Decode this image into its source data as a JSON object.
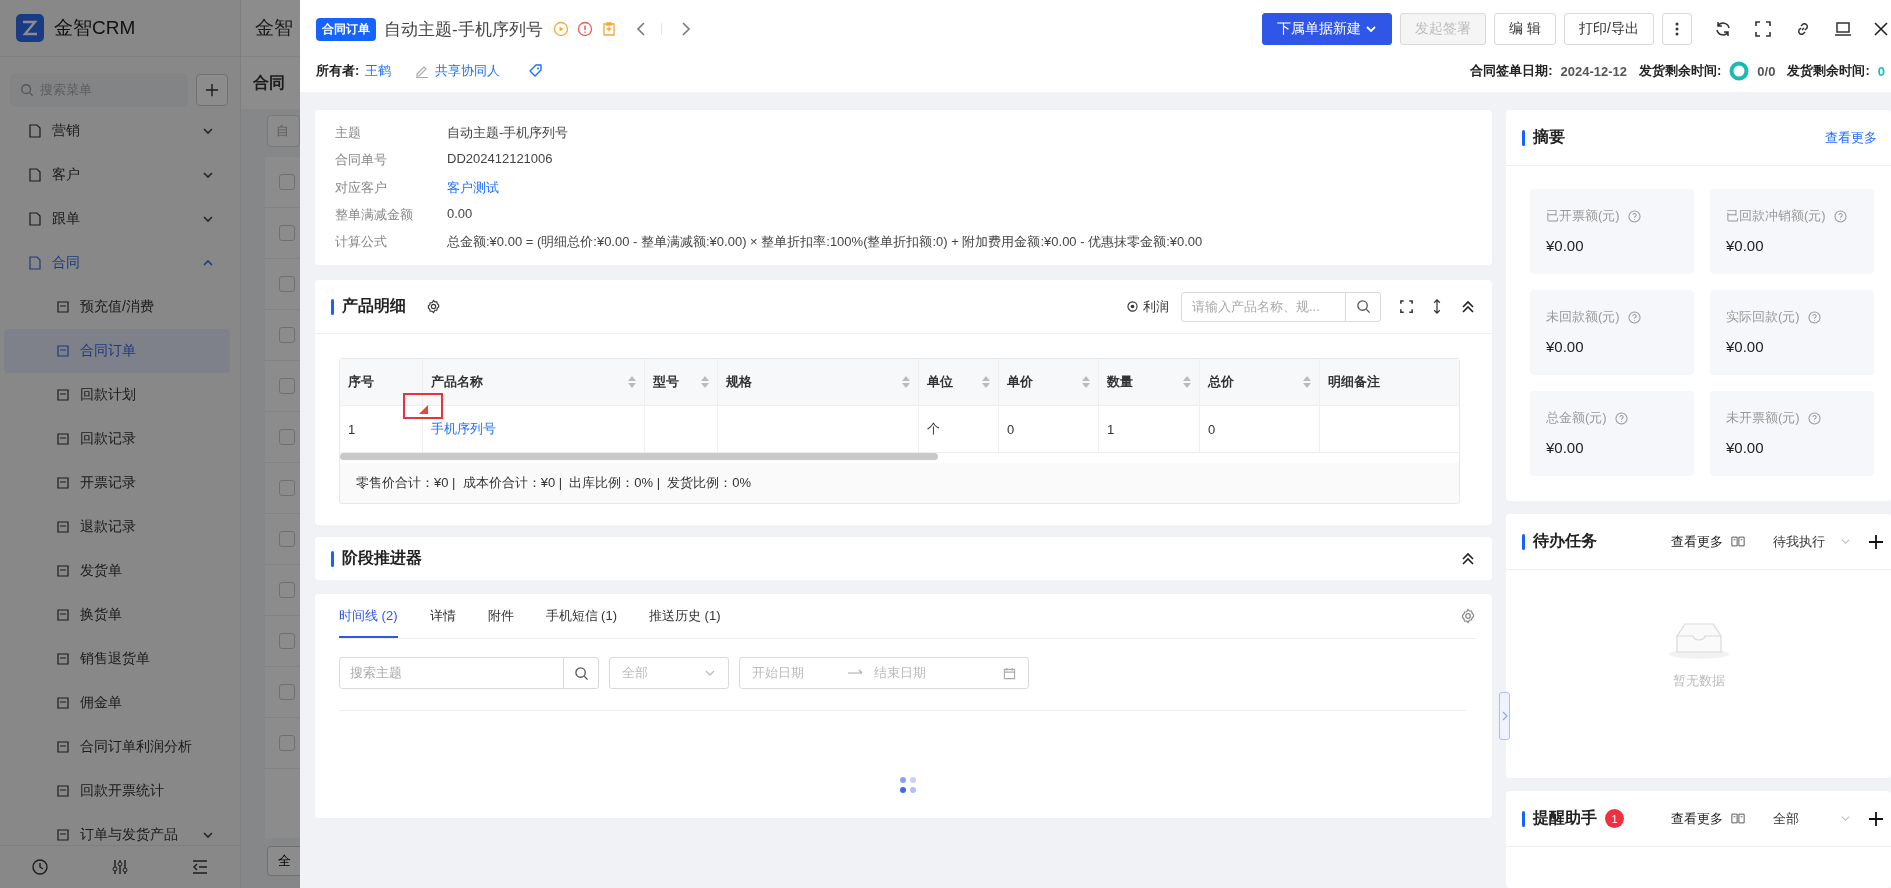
{
  "app": {
    "logo": "金智CRM",
    "header_text": "金智",
    "search_placeholder": "搜索菜单",
    "page_title": "合同",
    "filter_placeholder": "自",
    "footer_button": "全",
    "list_rows": [
      {
        "checked": false
      },
      {
        "checked": false
      },
      {
        "checked": false
      },
      {
        "checked": false
      },
      {
        "checked": false
      },
      {
        "checked": false
      },
      {
        "checked": false
      },
      {
        "checked": false
      },
      {
        "checked": false
      },
      {
        "checked": false
      },
      {
        "checked": false
      },
      {
        "checked": false
      }
    ]
  },
  "sidebar": {
    "items": [
      {
        "label": "营销",
        "expanded": false
      },
      {
        "label": "客户",
        "expanded": false
      },
      {
        "label": "跟单",
        "expanded": false
      },
      {
        "label": "合同",
        "expanded": true,
        "children": [
          {
            "label": "预充值/消费",
            "selected": false
          },
          {
            "label": "合同订单",
            "selected": true
          },
          {
            "label": "回款计划",
            "selected": false
          },
          {
            "label": "回款记录",
            "selected": false
          },
          {
            "label": "开票记录",
            "selected": false
          },
          {
            "label": "退款记录",
            "selected": false
          },
          {
            "label": "发货单",
            "selected": false
          },
          {
            "label": "换货单",
            "selected": false
          },
          {
            "label": "销售退货单",
            "selected": false
          },
          {
            "label": "佣金单",
            "selected": false
          },
          {
            "label": "合同订单利润分析",
            "selected": false
          },
          {
            "label": "回款开票统计",
            "selected": false
          },
          {
            "label": "订单与发货产品",
            "selected": false,
            "expanded": false
          }
        ]
      }
    ]
  },
  "drawer": {
    "badge": "合同订单",
    "title": "自动主题-手机序列号",
    "actions": [
      {
        "label": "下属单据新建",
        "kind": "primary",
        "disabled": false,
        "dropdown": true
      },
      {
        "label": "发起签署",
        "kind": "default",
        "disabled": true,
        "dropdown": false
      },
      {
        "label": "编 辑",
        "kind": "default",
        "disabled": false,
        "dropdown": false
      },
      {
        "label": "打印/导出",
        "kind": "default",
        "disabled": false,
        "dropdown": false
      }
    ],
    "owner_label": "所有者:",
    "owner": "王鹤",
    "share_label": "共享协同人",
    "meta": [
      {
        "label": "合同签单日期:",
        "value": "2024-12-12",
        "kind": "plain"
      },
      {
        "label": "发货剩余时间:",
        "value": "0/0",
        "kind": "ring"
      },
      {
        "label": "发货剩余时间:",
        "value": "0",
        "kind": "accent"
      }
    ]
  },
  "info": {
    "rows": [
      {
        "label": "主题",
        "value": "自动主题-手机序列号",
        "link": false
      },
      {
        "label": "合同单号",
        "value": "DD202412121006",
        "link": false
      },
      {
        "label": "对应客户",
        "value": "客户测试",
        "link": true
      },
      {
        "label": "整单满减金额",
        "value": "0.00",
        "link": false
      },
      {
        "label": "计算公式",
        "value": "总金额:¥0.00 = (明细总价:¥0.00 - 整单满减额:¥0.00) × 整单折扣率:100%(整单折扣额:0) + 附加费用金额:¥0.00 - 优惠抹零金额:¥0.00",
        "link": false
      }
    ]
  },
  "products": {
    "title": "产品明细",
    "profit_label": "利润",
    "search_placeholder": "请输入产品名称、规...",
    "columns": [
      {
        "label": "序号",
        "sortable": false
      },
      {
        "label": "产品名称",
        "sortable": true
      },
      {
        "label": "型号",
        "sortable": true
      },
      {
        "label": "规格",
        "sortable": true
      },
      {
        "label": "单位",
        "sortable": true
      },
      {
        "label": "单价",
        "sortable": true
      },
      {
        "label": "数量",
        "sortable": true
      },
      {
        "label": "总价",
        "sortable": true
      },
      {
        "label": "明细备注",
        "sortable": false
      }
    ],
    "rows": [
      {
        "cells": [
          {
            "text": "1",
            "link": false
          },
          {
            "text": "手机序列号",
            "link": true
          },
          null,
          null,
          {
            "text": "个",
            "link": false
          },
          {
            "text": "0",
            "link": false
          },
          {
            "text": "1",
            "link": false
          },
          {
            "text": "0",
            "link": false
          },
          null
        ],
        "flagged": true
      }
    ],
    "summary": "零售价合计：¥0 |  成本价合计：¥0 |  出库比例：0% |  发货比例：0%"
  },
  "stage": {
    "title": "阶段推进器"
  },
  "timeline": {
    "tabs": [
      {
        "label": "时间线 (2)",
        "selected": true
      },
      {
        "label": "详情",
        "selected": false
      },
      {
        "label": "附件",
        "selected": false
      },
      {
        "label": "手机短信 (1)",
        "selected": false
      },
      {
        "label": "推送历史 (1)",
        "selected": false
      }
    ],
    "search_placeholder": "搜索主题",
    "select_value": "全部",
    "start_placeholder": "开始日期",
    "end_placeholder": "结束日期"
  },
  "summary": {
    "title": "摘要",
    "more": "查看更多",
    "stats": [
      {
        "label": "已开票额(元)",
        "value": "¥0.00"
      },
      {
        "label": "已回款冲销额(元)",
        "value": "¥0.00"
      },
      {
        "label": "未回款额(元)",
        "value": "¥0.00"
      },
      {
        "label": "实际回款(元)",
        "value": "¥0.00"
      },
      {
        "label": "总金额(元)",
        "value": "¥0.00"
      },
      {
        "label": "未开票额(元)",
        "value": "¥0.00"
      }
    ]
  },
  "tasks": {
    "title": "待办任务",
    "more": "查看更多",
    "filter": "待我执行",
    "empty": "暂无数据"
  },
  "reminders": {
    "title": "提醒助手",
    "count": "1",
    "more": "查看更多",
    "filter": "全部"
  }
}
